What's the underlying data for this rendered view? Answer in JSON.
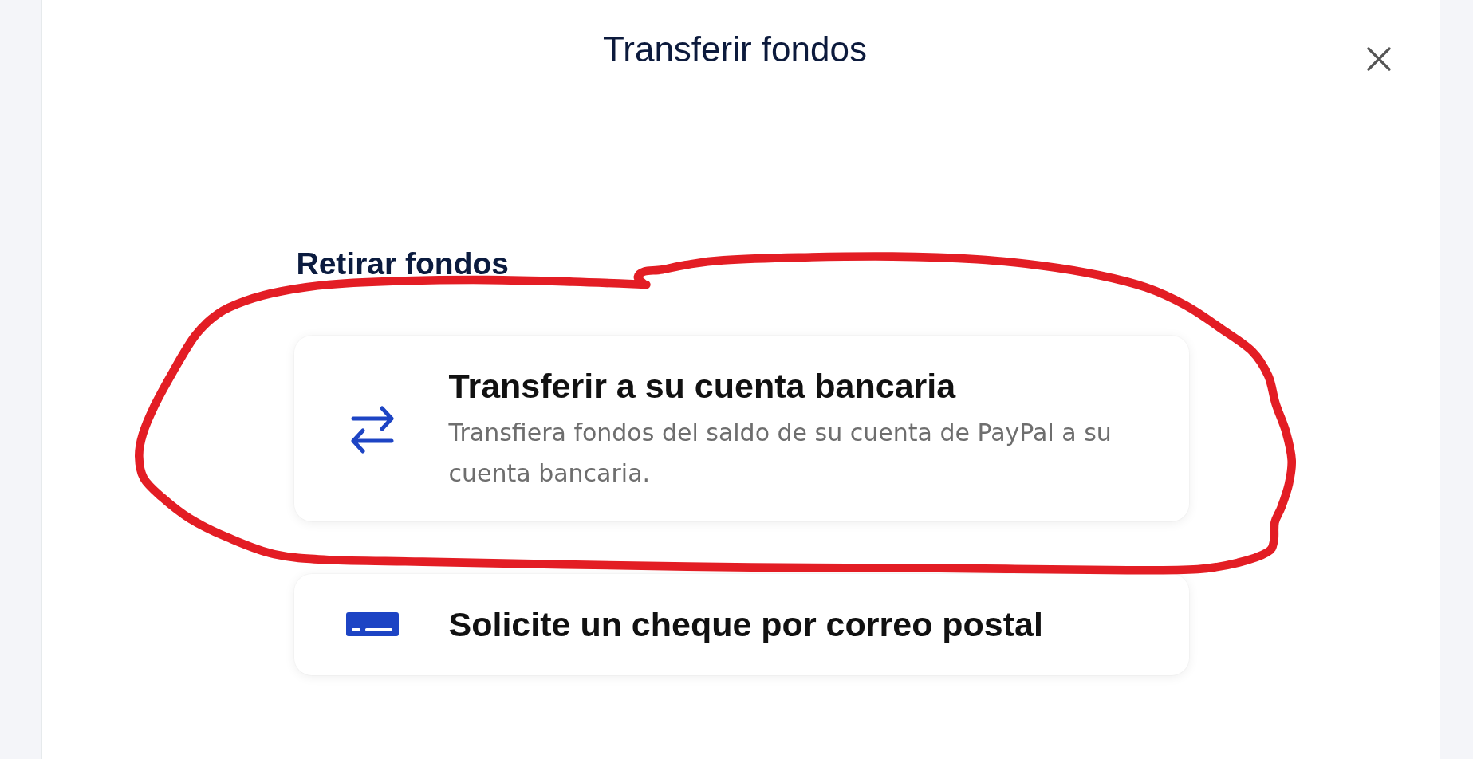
{
  "dialog": {
    "title": "Transferir fondos"
  },
  "section": {
    "heading": "Retirar fondos",
    "options": [
      {
        "kind": "transfer",
        "title": "Transferir a su cuenta bancaria",
        "description": "Transfiera fondos del saldo de su cuenta de PayPal a su cuenta bancaria."
      },
      {
        "kind": "check",
        "title": "Solicite un cheque por correo postal"
      }
    ]
  }
}
